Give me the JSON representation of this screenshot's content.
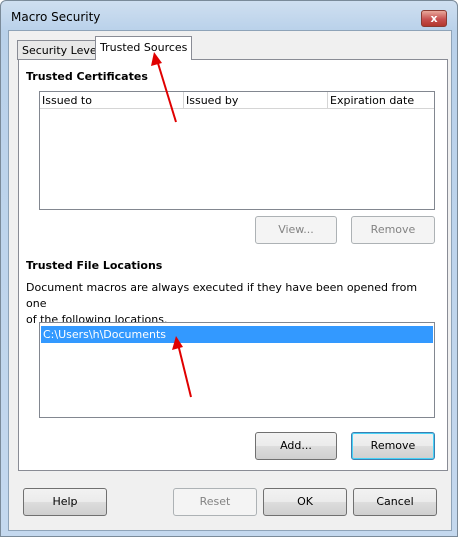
{
  "window": {
    "title": "Macro Security",
    "close_glyph": "x"
  },
  "tabs": [
    {
      "label": "Security Level"
    },
    {
      "label": "Trusted Sources"
    }
  ],
  "trusted_certificates": {
    "title": "Trusted Certificates",
    "columns": [
      "Issued to",
      "Issued by",
      "Expiration date"
    ],
    "rows": [],
    "view_label": "View...",
    "remove_label": "Remove"
  },
  "trusted_file_locations": {
    "title": "Trusted File Locations",
    "description_line1": "Document macros are always executed if they have been opened from one",
    "description_line2": "of the following locations.",
    "locations": [
      "C:\\Users\\h\\Documents"
    ],
    "add_label": "Add...",
    "remove_label": "Remove"
  },
  "footer": {
    "help_label": "Help",
    "reset_label": "Reset",
    "ok_label": "OK",
    "cancel_label": "Cancel"
  },
  "annotation_color": "#e00000"
}
